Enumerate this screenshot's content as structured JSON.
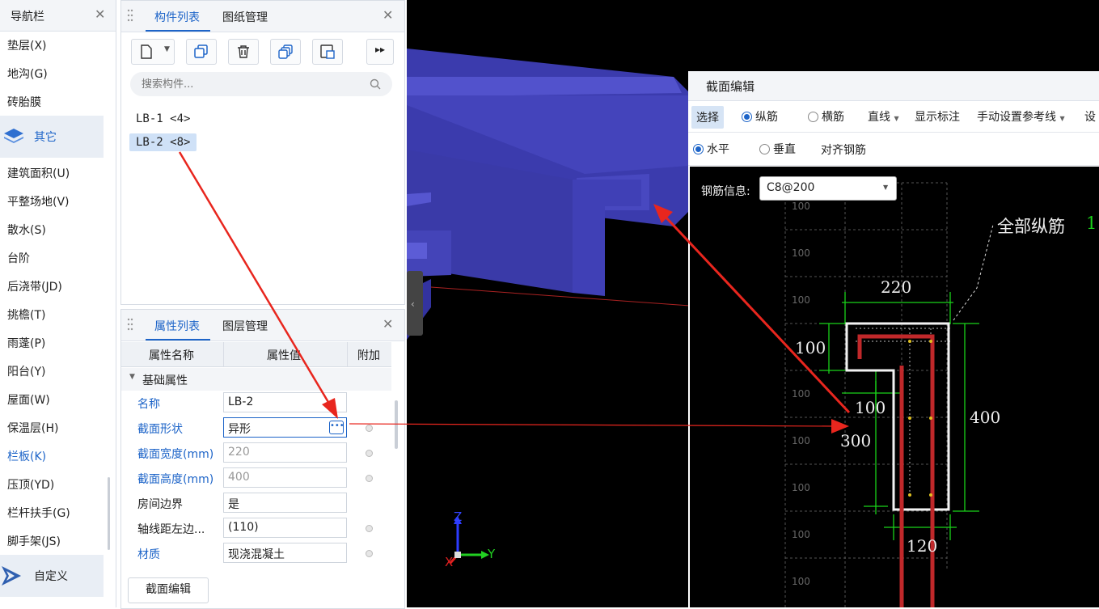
{
  "nav": {
    "title": "导航栏",
    "items_top": [
      "垫层(X)",
      "地沟(G)",
      "砖胎膜"
    ],
    "group_other": "其它",
    "items": [
      "建筑面积(U)",
      "平整场地(V)",
      "散水(S)",
      "台阶",
      "后浇带(JD)",
      "挑檐(T)",
      "雨蓬(P)",
      "阳台(Y)",
      "屋面(W)",
      "保温层(H)",
      "栏板(K)",
      "压顶(YD)",
      "栏杆扶手(G)",
      "脚手架(JS)"
    ],
    "active_item": "栏板(K)",
    "group_custom": "自定义"
  },
  "component_panel": {
    "tabs": [
      "构件列表",
      "图纸管理"
    ],
    "search_placeholder": "搜索构件...",
    "items": [
      "LB-1 <4>",
      "LB-2 <8>"
    ],
    "selected": "LB-2 <8>"
  },
  "property_panel": {
    "tabs": [
      "属性列表",
      "图层管理"
    ],
    "columns": [
      "属性名称",
      "属性值",
      "附加"
    ],
    "section": "基础属性",
    "rows": [
      {
        "name": "名称",
        "value": "LB-2"
      },
      {
        "name": "截面形状",
        "value": "异形"
      },
      {
        "name": "截面宽度(mm)",
        "value": "220"
      },
      {
        "name": "截面高度(mm)",
        "value": "400"
      },
      {
        "name": "房间边界",
        "value": "是"
      },
      {
        "name": "轴线距左边...",
        "value": "(110)"
      },
      {
        "name": "材质",
        "value": "现浇混凝土"
      }
    ],
    "edit_button": "截面编辑"
  },
  "dialog": {
    "title": "截面编辑",
    "toolbar1": {
      "select": "选择",
      "longitudinal": "纵筋",
      "transverse": "横筋",
      "line": "直线",
      "show_dim": "显示标注",
      "manual_ref": "手动设置参考线",
      "more": "设"
    },
    "toolbar2": {
      "horizontal": "水平",
      "vertical": "垂直",
      "align": "对齐钢筋"
    },
    "rebar_label": "钢筋信息:",
    "rebar_value": "C8@200",
    "all_long": "全部纵筋",
    "all_long_tail": "1",
    "dims": {
      "d220": "220",
      "d100a": "100",
      "d100b": "100",
      "d300": "300",
      "d400": "400",
      "d120": "120"
    },
    "grid_label": "100"
  },
  "axes": {
    "z": "Z",
    "y": "Y",
    "x": "X"
  },
  "colors": {
    "accent": "#1d64c8",
    "slab": "#4b4bc4",
    "dim": "#19d219",
    "rebar": "#c0282a",
    "arrow": "#e8261e"
  }
}
